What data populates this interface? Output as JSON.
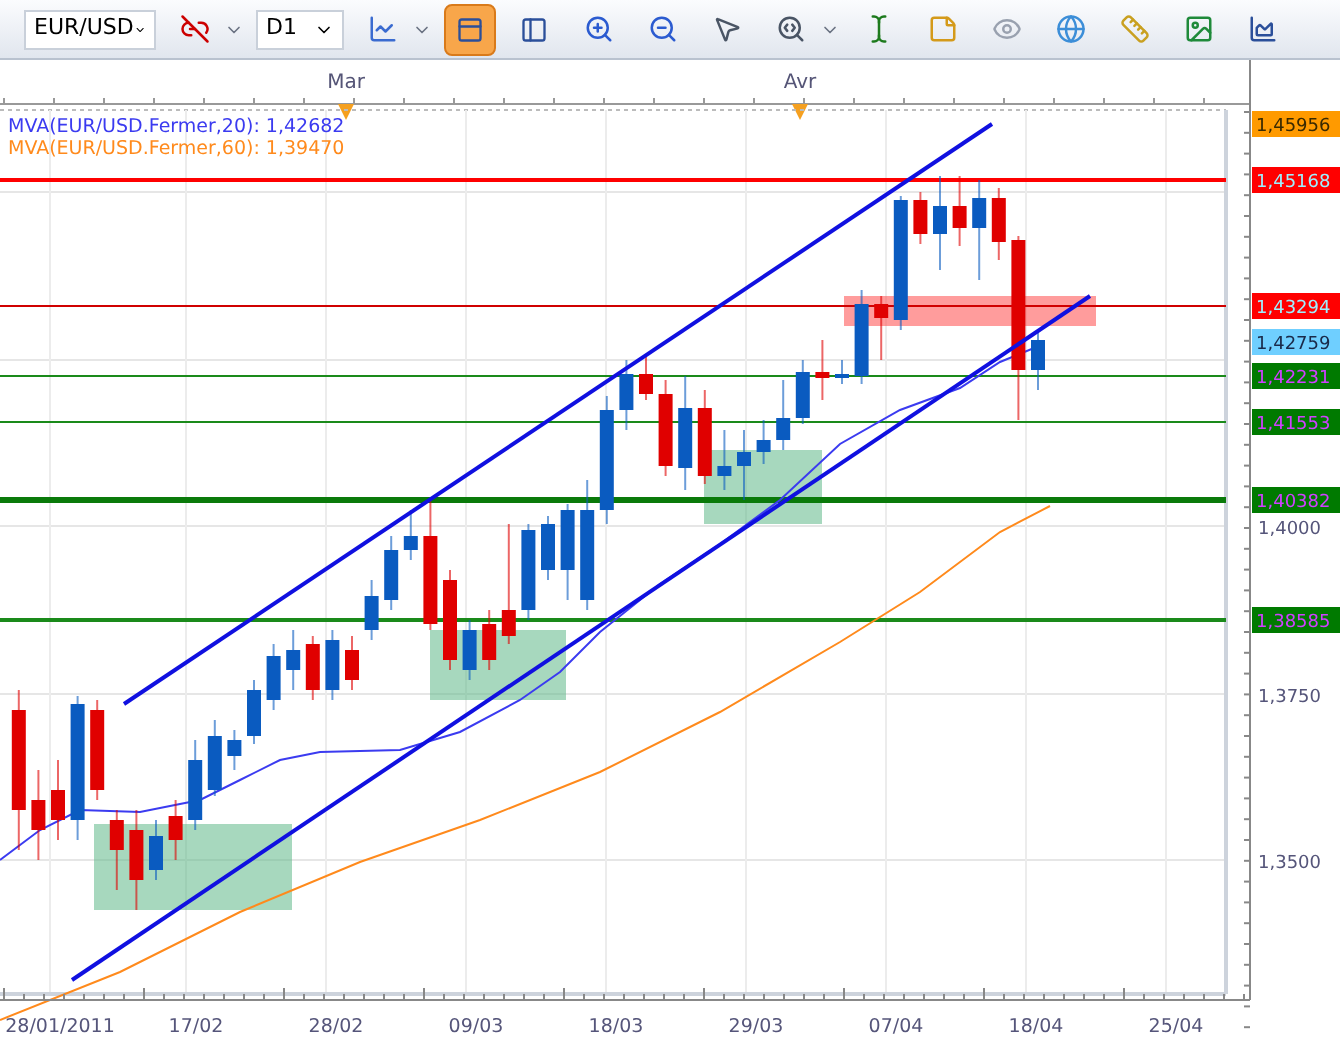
{
  "toolbar": {
    "symbol": "EUR/USD",
    "timeframe": "D1",
    "view_toggles": [
      {
        "selected": true
      },
      {
        "selected": false
      }
    ]
  },
  "time_ruler": {
    "months": [
      "Mar",
      "Avr"
    ]
  },
  "legend": [
    {
      "text": "MVA(EUR/USD.Fermer,20): 1,42682",
      "color": "#3b3bf0"
    },
    {
      "text": "MVA(EUR/USD.Fermer,60): 1,39470",
      "color": "#ff8a1c"
    }
  ],
  "price_tags": [
    {
      "text": "1,45956",
      "kind": "high"
    },
    {
      "text": "1,45168",
      "kind": "resistance"
    },
    {
      "text": "1,43294",
      "kind": "resistance"
    },
    {
      "text": "1,42759",
      "kind": "last"
    },
    {
      "text": "1,42231",
      "kind": "support"
    },
    {
      "text": "1,41553",
      "kind": "support"
    },
    {
      "text": "1,40382",
      "kind": "support"
    },
    {
      "text": "1,38585",
      "kind": "support"
    }
  ],
  "y_axis": [
    "1,4000",
    "1,3750",
    "1,3500"
  ],
  "x_axis": [
    "28/01/2011",
    "17/02",
    "28/02",
    "09/03",
    "18/03",
    "29/03",
    "07/04",
    "18/04",
    "25/04"
  ]
}
